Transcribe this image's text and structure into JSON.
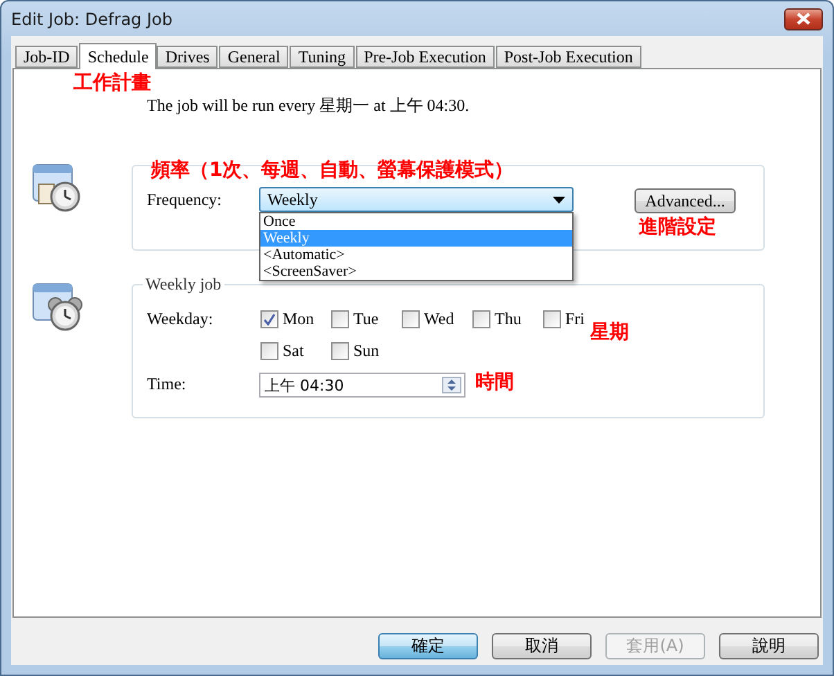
{
  "window": {
    "title": "Edit Job: Defrag Job"
  },
  "tabs": [
    {
      "label": "Job-ID",
      "selected": false
    },
    {
      "label": "Schedule",
      "selected": true
    },
    {
      "label": "Drives",
      "selected": false
    },
    {
      "label": "General",
      "selected": false
    },
    {
      "label": "Tuning",
      "selected": false
    },
    {
      "label": "Pre-Job Execution",
      "selected": false
    },
    {
      "label": "Post-Job Execution",
      "selected": false
    }
  ],
  "schedule": {
    "note": "工作計畫",
    "summary": "The job will be run every 星期一 at 上午 04:30."
  },
  "frequency": {
    "note": "頻率（1次、每週、自動、螢幕保護模式）",
    "label": "Frequency:",
    "value": "Weekly",
    "expanded": true,
    "options": [
      {
        "label": "Once",
        "selected": false
      },
      {
        "label": "Weekly",
        "selected": true
      },
      {
        "label": "<Automatic>",
        "selected": false
      },
      {
        "label": "<ScreenSaver>",
        "selected": false
      }
    ],
    "advanced_button": "Advanced...",
    "advanced_note": "進階設定"
  },
  "weekly_job": {
    "title": "Weekly job",
    "weekday_label": "Weekday:",
    "weekday_note": "星期",
    "days": [
      {
        "label": "Mon",
        "checked": true
      },
      {
        "label": "Tue",
        "checked": false
      },
      {
        "label": "Wed",
        "checked": false
      },
      {
        "label": "Thu",
        "checked": false
      },
      {
        "label": "Fri",
        "checked": false
      },
      {
        "label": "Sat",
        "checked": false
      },
      {
        "label": "Sun",
        "checked": false
      }
    ],
    "time_label": "Time:",
    "time_value": "上午 04:30",
    "time_note": "時間"
  },
  "buttons": [
    {
      "label": "確定",
      "default": true,
      "disabled": false
    },
    {
      "label": "取消",
      "default": false,
      "disabled": false
    },
    {
      "label": "套用(A)",
      "default": false,
      "disabled": true
    },
    {
      "label": "說明",
      "default": false,
      "disabled": false
    }
  ]
}
